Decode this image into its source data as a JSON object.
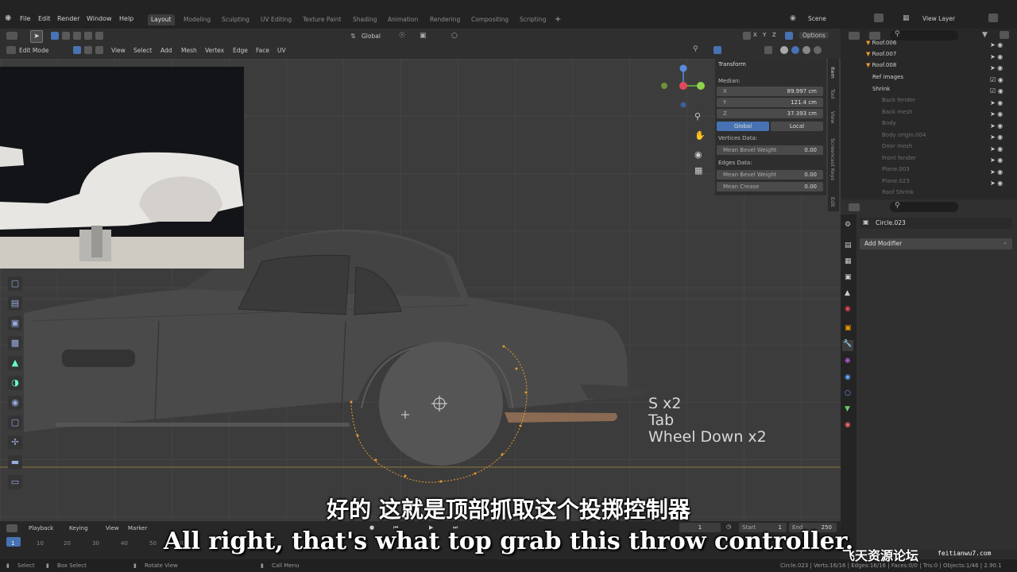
{
  "menu": [
    "File",
    "Edit",
    "Render",
    "Window",
    "Help"
  ],
  "workspaces": [
    "Layout",
    "Modeling",
    "Sculpting",
    "UV Editing",
    "Texture Paint",
    "Shading",
    "Animation",
    "Rendering",
    "Compositing",
    "Scripting"
  ],
  "scene_label": "Scene",
  "view_layer_label": "View Layer",
  "header": {
    "mode": "Edit Mode",
    "menus": [
      "View",
      "Select",
      "Add",
      "Mesh",
      "Vertex",
      "Edge",
      "Face",
      "UV"
    ],
    "orientation": "Global",
    "options": "Options"
  },
  "npanel": {
    "title": "Transform",
    "median_label": "Median:",
    "x_label": "X",
    "x_value": "89.997 cm",
    "y_label": "Y",
    "y_value": "121.4 cm",
    "z_label": "Z",
    "z_value": "37.393 cm",
    "global_btn": "Global",
    "local_btn": "Local",
    "vertices_data": "Vertices Data:",
    "mean_bevel_weight_v": "Mean Bevel Weight",
    "mbw_v_value": "0.00",
    "edges_data": "Edges Data:",
    "mean_bevel_weight_e": "Mean Bevel Weight",
    "mbw_e_value": "0.00",
    "mean_crease": "Mean Crease",
    "crease_value": "0.00",
    "tabs": [
      "Item",
      "Tool",
      "View",
      "Screencast Keys",
      "Edit"
    ]
  },
  "outliner": {
    "search_placeholder": "",
    "rows": [
      {
        "label": "Roof.006",
        "dim": false
      },
      {
        "label": "Roof.007",
        "dim": false
      },
      {
        "label": "Roof.008",
        "dim": false
      },
      {
        "label": "Ref images",
        "dim": false
      },
      {
        "label": "Shrink",
        "dim": false
      },
      {
        "label": "Back fender",
        "dim": true
      },
      {
        "label": "Back mesh",
        "dim": true
      },
      {
        "label": "Body",
        "dim": true
      },
      {
        "label": "Body origin.004",
        "dim": true
      },
      {
        "label": "Door mesh",
        "dim": true
      },
      {
        "label": "Front fender",
        "dim": true
      },
      {
        "label": "Plane.003",
        "dim": true
      },
      {
        "label": "Plane.023",
        "dim": true
      },
      {
        "label": "Roof Shrink",
        "dim": true
      }
    ]
  },
  "properties": {
    "object_name": "Circle.023",
    "add_modifier": "Add Modifier"
  },
  "timeline": {
    "menus": [
      "Playback",
      "Keying",
      "View",
      "Marker"
    ],
    "current_frame": "1",
    "start_label": "Start",
    "start_value": "1",
    "end_label": "End",
    "end_value": "250",
    "ticks": [
      "1",
      "10",
      "20",
      "30",
      "40",
      "50",
      "60"
    ]
  },
  "statusbar": {
    "select": "Select",
    "box_select": "Box Select",
    "rotate_view": "Rotate View",
    "call_menu": "Call Menu",
    "stats": "Circle.023 | Verts:16/16 | Edges:16/16 | Faces:0/0 | Tris:0 | Objects:1/46 | 2.90.1"
  },
  "keys_overlay": [
    "S x2",
    "Tab",
    "Wheel Down x2"
  ],
  "subtitle_zh": "好的 这就是顶部抓取这个投掷控制器",
  "subtitle_en": "All right, that's what top grab this throw controller.",
  "watermark": "飞天资源论坛",
  "watermark_site": "feitianwu7.com",
  "colors": {
    "accent_blue": "#4772b3",
    "selection_orange": "#e69a2e",
    "exhaust_copper": "#8a6a52"
  }
}
